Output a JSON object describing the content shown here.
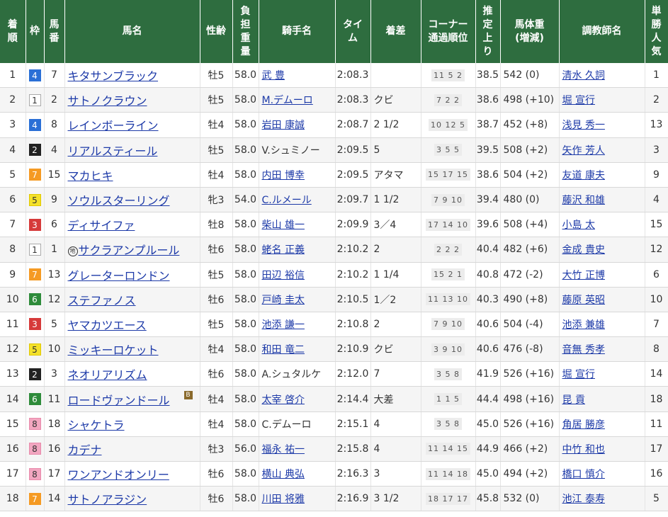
{
  "headers": {
    "rank": [
      "着",
      "順"
    ],
    "waku": [
      "枠"
    ],
    "umaban": [
      "馬",
      "番"
    ],
    "horse": [
      "馬名"
    ],
    "sexage": [
      "性齢"
    ],
    "weight": [
      "負",
      "担",
      "重",
      "量"
    ],
    "jockey": [
      "騎手名"
    ],
    "time": [
      "タイ",
      "ム"
    ],
    "margin": [
      "着差"
    ],
    "corner": [
      "コーナー",
      "通過順位"
    ],
    "last3f": [
      "推",
      "定",
      "上",
      "り"
    ],
    "bodyweight": [
      "馬体重",
      "(増減)"
    ],
    "trainer": [
      "調教師名"
    ],
    "pop": [
      "単",
      "勝",
      "人",
      "気"
    ]
  },
  "waku_colors": {
    "1": {
      "bg": "#ffffff",
      "fg": "#333333",
      "border": "#aaaaaa"
    },
    "2": {
      "bg": "#222222",
      "fg": "#ffffff",
      "border": "#222222"
    },
    "3": {
      "bg": "#d63a3a",
      "fg": "#ffffff",
      "border": "#d63a3a"
    },
    "4": {
      "bg": "#2a6fd6",
      "fg": "#ffffff",
      "border": "#2a6fd6"
    },
    "5": {
      "bg": "#f4e12a",
      "fg": "#333333",
      "border": "#e0c800"
    },
    "6": {
      "bg": "#2e8b3a",
      "fg": "#ffffff",
      "border": "#2e8b3a"
    },
    "7": {
      "bg": "#f59a23",
      "fg": "#ffffff",
      "border": "#f59a23"
    },
    "8": {
      "bg": "#f2a6c0",
      "fg": "#333333",
      "border": "#e88aab"
    }
  },
  "rows": [
    {
      "rank": "1",
      "waku": "4",
      "umaban": "7",
      "horse": "キタサンブラック",
      "mark": "",
      "blinker": "",
      "sexage": "牡5",
      "weight": "58.0",
      "jockey": "武 豊",
      "jockey_link": true,
      "time": "2:08.3",
      "margin": "",
      "corner": "11 5 2",
      "last3f": "38.5",
      "bodyweight": "542 (0)",
      "trainer": "清水 久詞",
      "pop": "1"
    },
    {
      "rank": "2",
      "waku": "1",
      "umaban": "2",
      "horse": "サトノクラウン",
      "mark": "",
      "blinker": "",
      "sexage": "牡5",
      "weight": "58.0",
      "jockey": "M.デムーロ",
      "jockey_link": true,
      "time": "2:08.3",
      "margin": "クビ",
      "corner": "7 2 2",
      "last3f": "38.6",
      "bodyweight": "498 (+10)",
      "trainer": "堀 宣行",
      "pop": "2"
    },
    {
      "rank": "3",
      "waku": "4",
      "umaban": "8",
      "horse": "レインボーライン",
      "mark": "",
      "blinker": "",
      "sexage": "牡4",
      "weight": "58.0",
      "jockey": "岩田 康誠",
      "jockey_link": true,
      "time": "2:08.7",
      "margin": "2 1/2",
      "corner": "10 12 5",
      "last3f": "38.7",
      "bodyweight": "452 (+8)",
      "trainer": "浅見 秀一",
      "pop": "13"
    },
    {
      "rank": "4",
      "waku": "2",
      "umaban": "4",
      "horse": "リアルスティール",
      "mark": "",
      "blinker": "",
      "sexage": "牡5",
      "weight": "58.0",
      "jockey": "V.シュミノー",
      "jockey_link": false,
      "time": "2:09.5",
      "margin": "5",
      "corner": "3 5 5",
      "last3f": "39.5",
      "bodyweight": "508 (+2)",
      "trainer": "矢作 芳人",
      "pop": "3"
    },
    {
      "rank": "5",
      "waku": "7",
      "umaban": "15",
      "horse": "マカヒキ",
      "mark": "",
      "blinker": "",
      "sexage": "牡4",
      "weight": "58.0",
      "jockey": "内田 博幸",
      "jockey_link": true,
      "time": "2:09.5",
      "margin": "アタマ",
      "corner": "15 17 15",
      "last3f": "38.6",
      "bodyweight": "504 (+2)",
      "trainer": "友道 康夫",
      "pop": "9"
    },
    {
      "rank": "6",
      "waku": "5",
      "umaban": "9",
      "horse": "ソウルスターリング",
      "mark": "",
      "blinker": "",
      "sexage": "牝3",
      "weight": "54.0",
      "jockey": "C.ルメール",
      "jockey_link": true,
      "time": "2:09.7",
      "margin": "1 1/2",
      "corner": "7 9 10",
      "last3f": "39.4",
      "bodyweight": "480 (0)",
      "trainer": "藤沢 和雄",
      "pop": "4"
    },
    {
      "rank": "7",
      "waku": "3",
      "umaban": "6",
      "horse": "ディサイファ",
      "mark": "",
      "blinker": "",
      "sexage": "牡8",
      "weight": "58.0",
      "jockey": "柴山 雄一",
      "jockey_link": true,
      "time": "2:09.9",
      "margin": "3／4",
      "corner": "17 14 10",
      "last3f": "39.6",
      "bodyweight": "508 (+4)",
      "trainer": "小島 太",
      "pop": "15"
    },
    {
      "rank": "8",
      "waku": "1",
      "umaban": "1",
      "horse": "サクラアンプルール",
      "mark": "地",
      "blinker": "",
      "sexage": "牡6",
      "weight": "58.0",
      "jockey": "蛯名 正義",
      "jockey_link": true,
      "time": "2:10.2",
      "margin": "2",
      "corner": "2 2 2",
      "last3f": "40.4",
      "bodyweight": "482 (+6)",
      "trainer": "金成 貴史",
      "pop": "12"
    },
    {
      "rank": "9",
      "waku": "7",
      "umaban": "13",
      "horse": "グレーターロンドン",
      "mark": "",
      "blinker": "",
      "sexage": "牡5",
      "weight": "58.0",
      "jockey": "田辺 裕信",
      "jockey_link": true,
      "time": "2:10.2",
      "margin": "1 1/4",
      "corner": "15 2 1",
      "last3f": "40.8",
      "bodyweight": "472 (-2)",
      "trainer": "大竹 正博",
      "pop": "6"
    },
    {
      "rank": "10",
      "waku": "6",
      "umaban": "12",
      "horse": "ステファノス",
      "mark": "",
      "blinker": "",
      "sexage": "牡6",
      "weight": "58.0",
      "jockey": "戸崎 圭太",
      "jockey_link": true,
      "time": "2:10.5",
      "margin": "1／2",
      "corner": "11 13 10",
      "last3f": "40.3",
      "bodyweight": "490 (+8)",
      "trainer": "藤原 英昭",
      "pop": "10"
    },
    {
      "rank": "11",
      "waku": "3",
      "umaban": "5",
      "horse": "ヤマカツエース",
      "mark": "",
      "blinker": "",
      "sexage": "牡5",
      "weight": "58.0",
      "jockey": "池添 謙一",
      "jockey_link": true,
      "time": "2:10.8",
      "margin": "2",
      "corner": "7 9 10",
      "last3f": "40.6",
      "bodyweight": "504 (-4)",
      "trainer": "池添 兼雄",
      "pop": "7"
    },
    {
      "rank": "12",
      "waku": "5",
      "umaban": "10",
      "horse": "ミッキーロケット",
      "mark": "",
      "blinker": "",
      "sexage": "牡4",
      "weight": "58.0",
      "jockey": "和田 竜二",
      "jockey_link": true,
      "time": "2:10.9",
      "margin": "クビ",
      "corner": "3 9 10",
      "last3f": "40.6",
      "bodyweight": "476 (-8)",
      "trainer": "音無 秀孝",
      "pop": "8"
    },
    {
      "rank": "13",
      "waku": "2",
      "umaban": "3",
      "horse": "ネオリアリズム",
      "mark": "",
      "blinker": "",
      "sexage": "牡6",
      "weight": "58.0",
      "jockey": "A.シュタルケ",
      "jockey_link": false,
      "time": "2:12.0",
      "margin": "7",
      "corner": "3 5 8",
      "last3f": "41.9",
      "bodyweight": "526 (+16)",
      "trainer": "堀 宣行",
      "pop": "14"
    },
    {
      "rank": "14",
      "waku": "6",
      "umaban": "11",
      "horse": "ロードヴァンドール",
      "mark": "",
      "blinker": "B",
      "sexage": "牡4",
      "weight": "58.0",
      "jockey": "太宰 啓介",
      "jockey_link": true,
      "time": "2:14.4",
      "margin": "大差",
      "corner": "1 1 5",
      "last3f": "44.4",
      "bodyweight": "498 (+16)",
      "trainer": "昆 貢",
      "pop": "18"
    },
    {
      "rank": "15",
      "waku": "8",
      "umaban": "18",
      "horse": "シャケトラ",
      "mark": "",
      "blinker": "",
      "sexage": "牡4",
      "weight": "58.0",
      "jockey": "C.デムーロ",
      "jockey_link": false,
      "time": "2:15.1",
      "margin": "4",
      "corner": "3 5 8",
      "last3f": "45.0",
      "bodyweight": "526 (+16)",
      "trainer": "角居 勝彦",
      "pop": "11"
    },
    {
      "rank": "16",
      "waku": "8",
      "umaban": "16",
      "horse": "カデナ",
      "mark": "",
      "blinker": "",
      "sexage": "牡3",
      "weight": "56.0",
      "jockey": "福永 祐一",
      "jockey_link": true,
      "time": "2:15.8",
      "margin": "4",
      "corner": "11 14 15",
      "last3f": "44.9",
      "bodyweight": "466 (+2)",
      "trainer": "中竹 和也",
      "pop": "17"
    },
    {
      "rank": "17",
      "waku": "8",
      "umaban": "17",
      "horse": "ワンアンドオンリー",
      "mark": "",
      "blinker": "",
      "sexage": "牡6",
      "weight": "58.0",
      "jockey": "横山 典弘",
      "jockey_link": true,
      "time": "2:16.3",
      "margin": "3",
      "corner": "11 14 18",
      "last3f": "45.0",
      "bodyweight": "494 (+2)",
      "trainer": "橋口 慎介",
      "pop": "16"
    },
    {
      "rank": "18",
      "waku": "7",
      "umaban": "14",
      "horse": "サトノアラジン",
      "mark": "",
      "blinker": "",
      "sexage": "牡6",
      "weight": "58.0",
      "jockey": "川田 将雅",
      "jockey_link": true,
      "time": "2:16.9",
      "margin": "3 1/2",
      "corner": "18 17 17",
      "last3f": "45.8",
      "bodyweight": "532 (0)",
      "trainer": "池江 泰寿",
      "pop": "5"
    }
  ]
}
